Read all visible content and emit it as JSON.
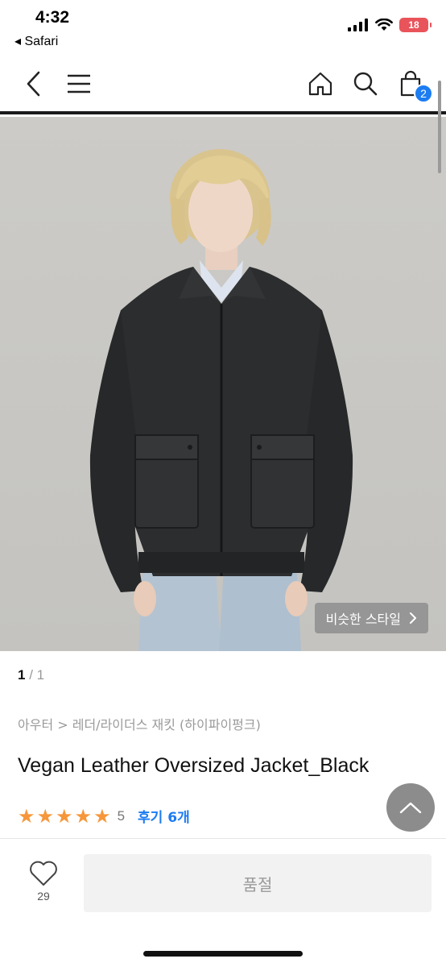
{
  "status_bar": {
    "time": "4:32",
    "back_app": "◂ Safari",
    "battery": "18"
  },
  "nav": {
    "cart_count": "2"
  },
  "product": {
    "similar_style": "비슷한 스타일",
    "pager_current": "1",
    "pager_total": " / 1",
    "breadcrumb": "아우터 > 레더/라이더스 재킷 (하이파이펑크)",
    "title": "Vegan Leather Oversized Jacket_Black",
    "rating": 5,
    "rating_label": "5",
    "review_link": "후기 6개"
  },
  "bottom": {
    "like_count": "29",
    "soldout_label": "품절"
  },
  "colors": {
    "accent": "#1c7cf2",
    "star": "#f6973a",
    "image_bg": "#c9c8c4"
  }
}
